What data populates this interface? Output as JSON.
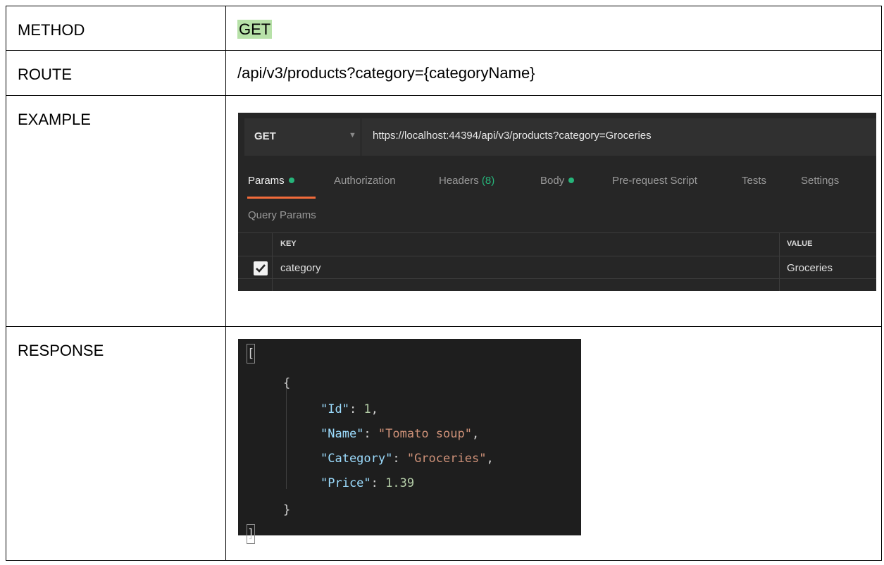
{
  "rows": [
    {
      "label": "METHOD",
      "value": "GET"
    },
    {
      "label": "ROUTE",
      "value": "/api/v3/products?category={categoryName}"
    },
    {
      "label": "EXAMPLE"
    },
    {
      "label": "RESPONSE"
    }
  ],
  "postman": {
    "method": "GET",
    "url": "https://localhost:44394/api/v3/products?category=Groceries",
    "tabs": {
      "params": "Params",
      "authorization": "Authorization",
      "headers": "Headers",
      "headers_count": "(8)",
      "body": "Body",
      "pre_request": "Pre-request Script",
      "tests": "Tests",
      "settings": "Settings"
    },
    "query_params_title": "Query Params",
    "table": {
      "key_header": "KEY",
      "value_header": "VALUE",
      "row_key": "category",
      "row_value": "Groceries"
    },
    "colors": {
      "active_underline": "#f26b3a",
      "status_dot": "#26b47a"
    }
  },
  "response": {
    "open_bracket": "[",
    "open_brace": "{",
    "fields": [
      {
        "key": "\"Id\"",
        "value": "1",
        "type": "number",
        "comma": ","
      },
      {
        "key": "\"Name\"",
        "value": "\"Tomato soup\"",
        "type": "string",
        "comma": ","
      },
      {
        "key": "\"Category\"",
        "value": "\"Groceries\"",
        "type": "string",
        "comma": ","
      },
      {
        "key": "\"Price\"",
        "value": "1.39",
        "type": "number",
        "comma": ""
      }
    ],
    "close_brace": "}",
    "close_bracket": "]"
  }
}
